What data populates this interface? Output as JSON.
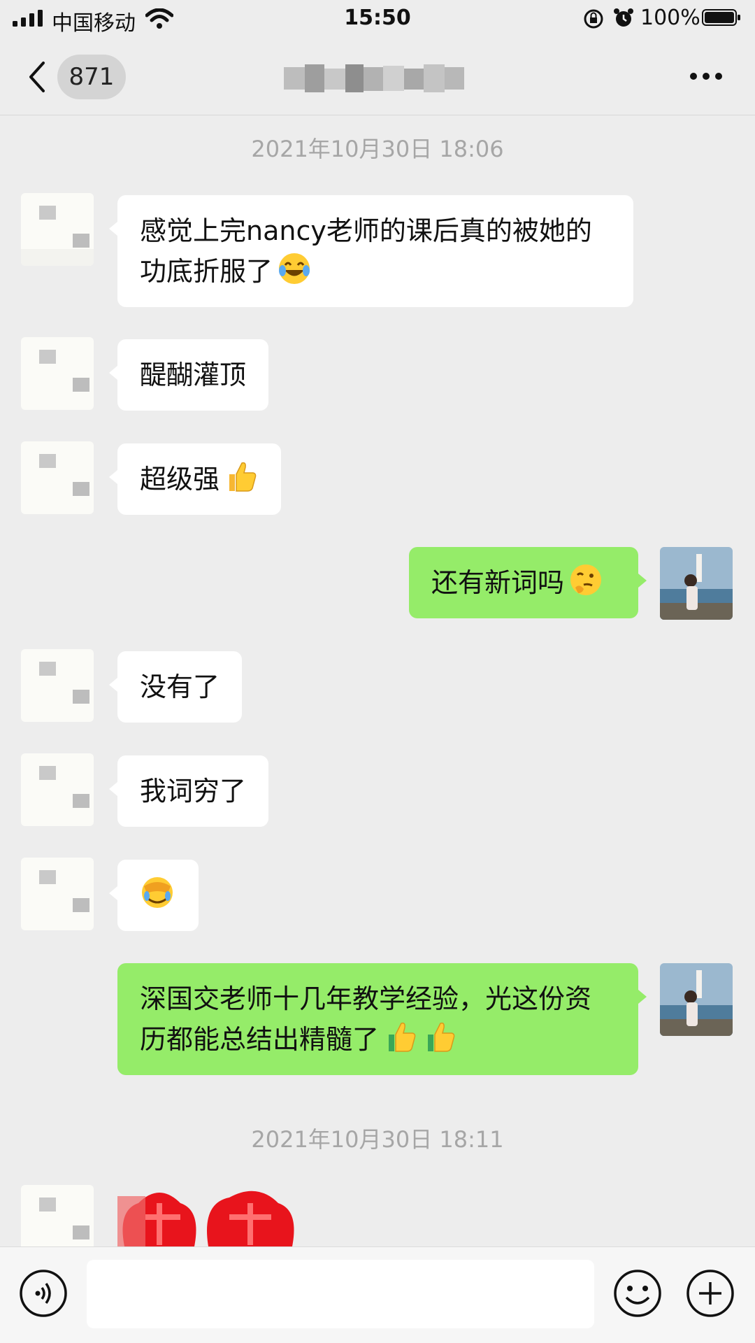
{
  "status_bar": {
    "carrier": "中国移动",
    "time": "15:50",
    "battery": "100%"
  },
  "nav": {
    "unread_count": "871",
    "title_blurred": true
  },
  "chat": {
    "timestamps": [
      "2021年10月30日 18:06",
      "2021年10月30日 18:11"
    ],
    "messages": [
      {
        "from": "other",
        "text": "感觉上完nancy老师的课后真的被她的功底折服了",
        "emoji": "laughing-tears"
      },
      {
        "from": "other",
        "text": "醍醐灌顶"
      },
      {
        "from": "other",
        "text": "超级强",
        "emoji": "thumbs-up"
      },
      {
        "from": "me",
        "text": "还有新词吗",
        "emoji": "thinking"
      },
      {
        "from": "other",
        "text": "没有了"
      },
      {
        "from": "other",
        "text": "我词穷了"
      },
      {
        "from": "other",
        "text": "",
        "emoji": "facepalm"
      },
      {
        "from": "me",
        "text": "深国交老师十几年教学经验，光这份资历都能总结出精髓了",
        "emoji": "thumbs-up-x2"
      },
      {
        "from": "other",
        "sticker": "red-sticker"
      }
    ]
  },
  "input": {
    "placeholder": "",
    "voice_icon": "voice-icon",
    "emoji_icon": "emoji-icon",
    "plus_icon": "plus-icon"
  },
  "colors": {
    "background": "#ededed",
    "bubble_out": "#95ec69",
    "bubble_in": "#ffffff",
    "timestamp": "#a6a6a6"
  }
}
